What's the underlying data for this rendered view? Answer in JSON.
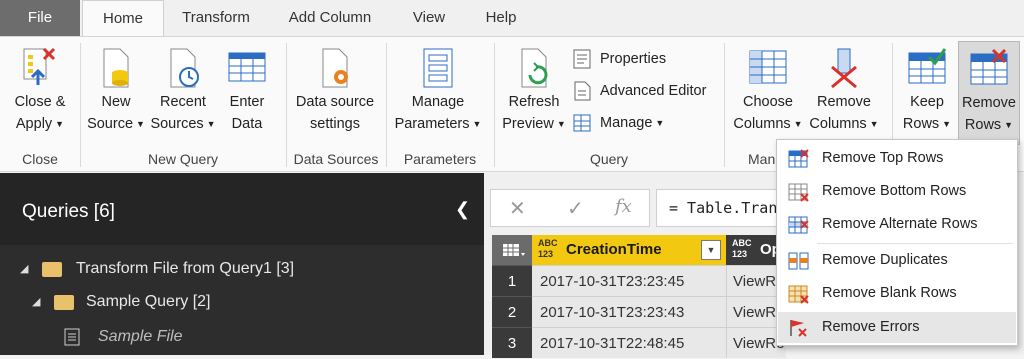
{
  "tabs": [
    "File",
    "Home",
    "Transform",
    "Add Column",
    "View",
    "Help"
  ],
  "ribbon": {
    "close_apply": [
      "Close &",
      "Apply"
    ],
    "new_source": [
      "New",
      "Source"
    ],
    "recent_sources": [
      "Recent",
      "Sources"
    ],
    "enter_data": [
      "Enter",
      "Data"
    ],
    "data_source_settings": [
      "Data source",
      "settings"
    ],
    "manage_parameters": [
      "Manage",
      "Parameters"
    ],
    "refresh_preview": [
      "Refresh",
      "Preview"
    ],
    "properties": "Properties",
    "advanced_editor": "Advanced Editor",
    "manage": "Manage",
    "choose_columns": [
      "Choose",
      "Columns"
    ],
    "remove_columns": [
      "Remove",
      "Columns"
    ],
    "keep_rows": [
      "Keep",
      "Rows"
    ],
    "remove_rows": [
      "Remove",
      "Rows"
    ],
    "groups": {
      "close": "Close",
      "new_query": "New Query",
      "data_sources": "Data Sources",
      "parameters": "Parameters",
      "query": "Query",
      "manage_cols": "Man"
    }
  },
  "queries": {
    "title": "Queries [6]",
    "items": [
      {
        "label": "Transform File from Query1 [3]"
      },
      {
        "label": "Sample Query [2]"
      },
      {
        "label": "Sample File"
      }
    ]
  },
  "formula_bar": {
    "cancel": "✕",
    "confirm": "✓",
    "fx": "fx",
    "text": "= Table.Tran"
  },
  "grid": {
    "col1_type": [
      "ABC",
      "123"
    ],
    "col1_name": "CreationTime",
    "col2_type": [
      "ABC",
      "123"
    ],
    "col2_name": "Op",
    "rows": [
      {
        "n": "1",
        "c1": "2017-10-31T23:23:45",
        "c2": "ViewRe"
      },
      {
        "n": "2",
        "c1": "2017-10-31T23:23:43",
        "c2": "ViewRe"
      },
      {
        "n": "3",
        "c1": "2017-10-31T22:48:45",
        "c2": "ViewRe"
      }
    ]
  },
  "menu": {
    "items": [
      {
        "label": "Remove Top Rows"
      },
      {
        "label": "Remove Bottom Rows"
      },
      {
        "label": "Remove Alternate Rows"
      },
      {
        "label": "Remove Duplicates"
      },
      {
        "label": "Remove Blank Rows"
      },
      {
        "label": "Remove Errors"
      }
    ]
  }
}
